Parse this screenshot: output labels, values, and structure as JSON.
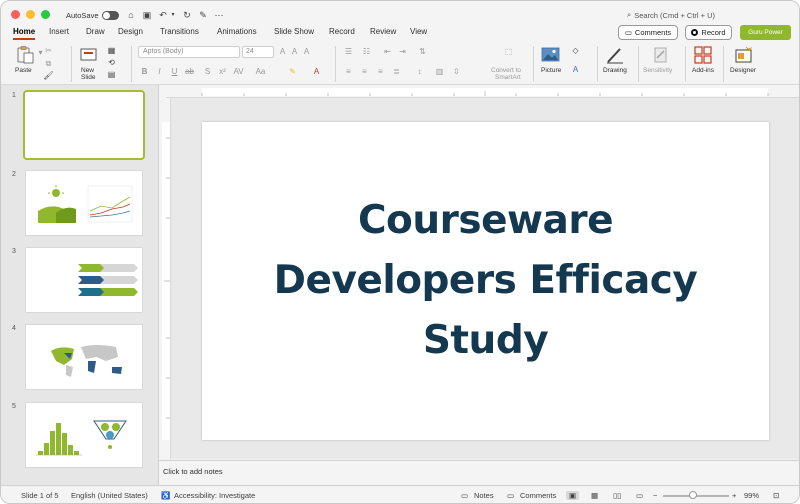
{
  "titlebar": {
    "autosave_label": "AutoSave",
    "search_placeholder": "Search (Cmd + Ctrl + U)"
  },
  "tabs": [
    "Home",
    "Insert",
    "Draw",
    "Design",
    "Transitions",
    "Animations",
    "Slide Show",
    "Record",
    "Review",
    "View"
  ],
  "actions": {
    "comments": "Comments",
    "record": "Record",
    "guru": "Guru Power"
  },
  "ribbon": {
    "paste": "Paste",
    "new_slide_1": "New",
    "new_slide_2": "Slide",
    "font_name": "Aptos (Body)",
    "font_size": "24",
    "convert_smartart_1": "Convert to",
    "convert_smartart_2": "SmartArt",
    "picture": "Picture",
    "drawing": "Drawing",
    "sensitivity": "Sensitivity",
    "addins": "Add-ins",
    "designer": "Designer"
  },
  "slides": [
    {
      "number": "1"
    },
    {
      "number": "2"
    },
    {
      "number": "3"
    },
    {
      "number": "4"
    },
    {
      "number": "5"
    }
  ],
  "main_slide": {
    "title_line1": "Courseware",
    "title_line2": "Developers Efficacy",
    "title_line3": "Study"
  },
  "notes_placeholder": "Click to add notes",
  "statusbar": {
    "slide_of": "Slide 1 of 5",
    "language": "English (United States)",
    "accessibility": "Accessibility: Investigate",
    "notes": "Notes",
    "comments": "Comments",
    "zoom": "99%"
  },
  "colors": {
    "title_text": "#14384f",
    "accent_green": "#8fb82c",
    "selected_border": "#a7b93a",
    "tab_underline": "#c43e1c"
  }
}
